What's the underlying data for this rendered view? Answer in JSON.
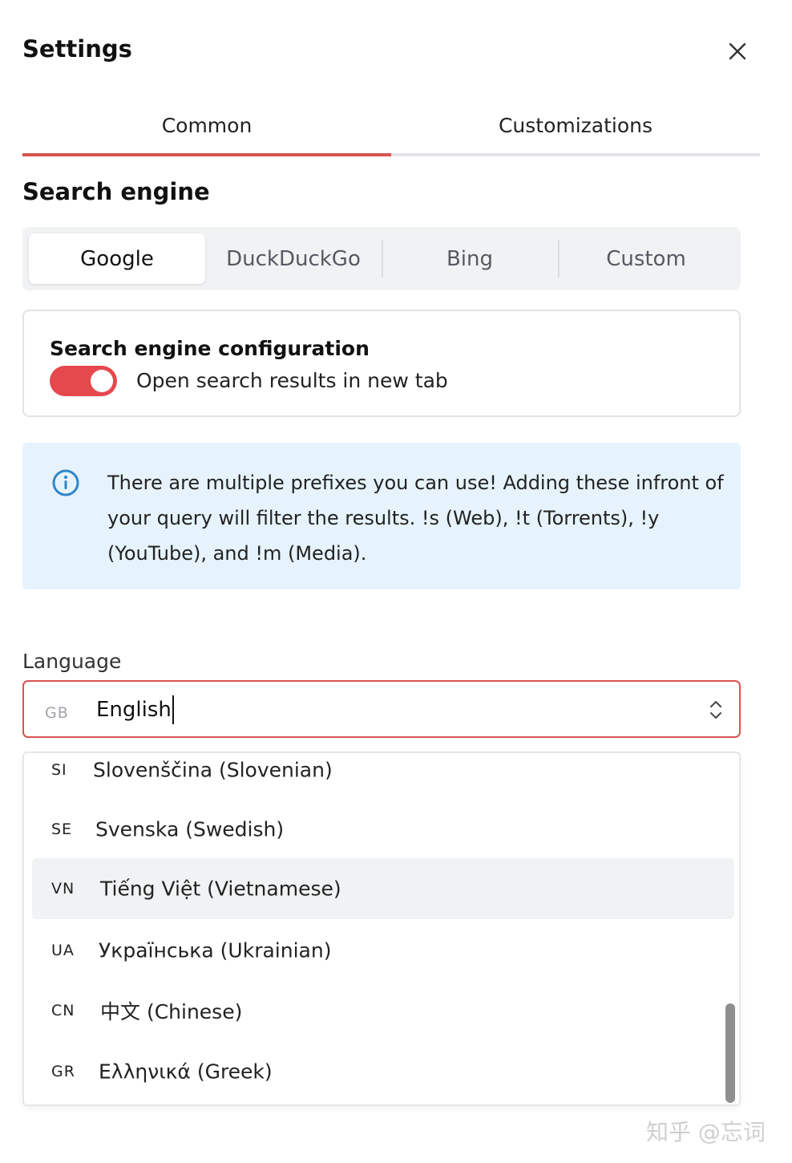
{
  "header": {
    "title": "Settings"
  },
  "tabs": [
    {
      "label": "Common",
      "active": true
    },
    {
      "label": "Customizations",
      "active": false
    }
  ],
  "search_engine": {
    "section_title": "Search engine",
    "options": [
      "Google",
      "DuckDuckGo",
      "Bing",
      "Custom"
    ],
    "selected": "Google",
    "config": {
      "title": "Search engine configuration",
      "toggle_label": "Open search results in new tab",
      "toggle_on": true
    }
  },
  "info": {
    "text": "There are multiple prefixes you can use! Adding these infront of your query will filter the results. !s (Web), !t (Torrents), !y (YouTube), and !m (Media)."
  },
  "language": {
    "label": "Language",
    "selected_code": "GB",
    "input_value": "English",
    "options": [
      {
        "code": "SI",
        "label": "Slovenščina (Slovenian)"
      },
      {
        "code": "SE",
        "label": "Svenska (Swedish)"
      },
      {
        "code": "VN",
        "label": "Tiếng Việt (Vietnamese)"
      },
      {
        "code": "UA",
        "label": "Українська (Ukrainian)"
      },
      {
        "code": "CN",
        "label": "中文 (Chinese)"
      },
      {
        "code": "GR",
        "label": "Ελληνικά (Greek)"
      }
    ],
    "highlighted_index": 2
  },
  "watermark": "知乎 @忘词",
  "colors": {
    "accent": "#d9534f",
    "toggle": "#e5484d",
    "info_bg": "#e6f3fc",
    "info_icon": "#2f86c8"
  },
  "icons": {
    "close": "close-icon",
    "info": "info-icon",
    "select": "chevron-up-down-icon"
  }
}
